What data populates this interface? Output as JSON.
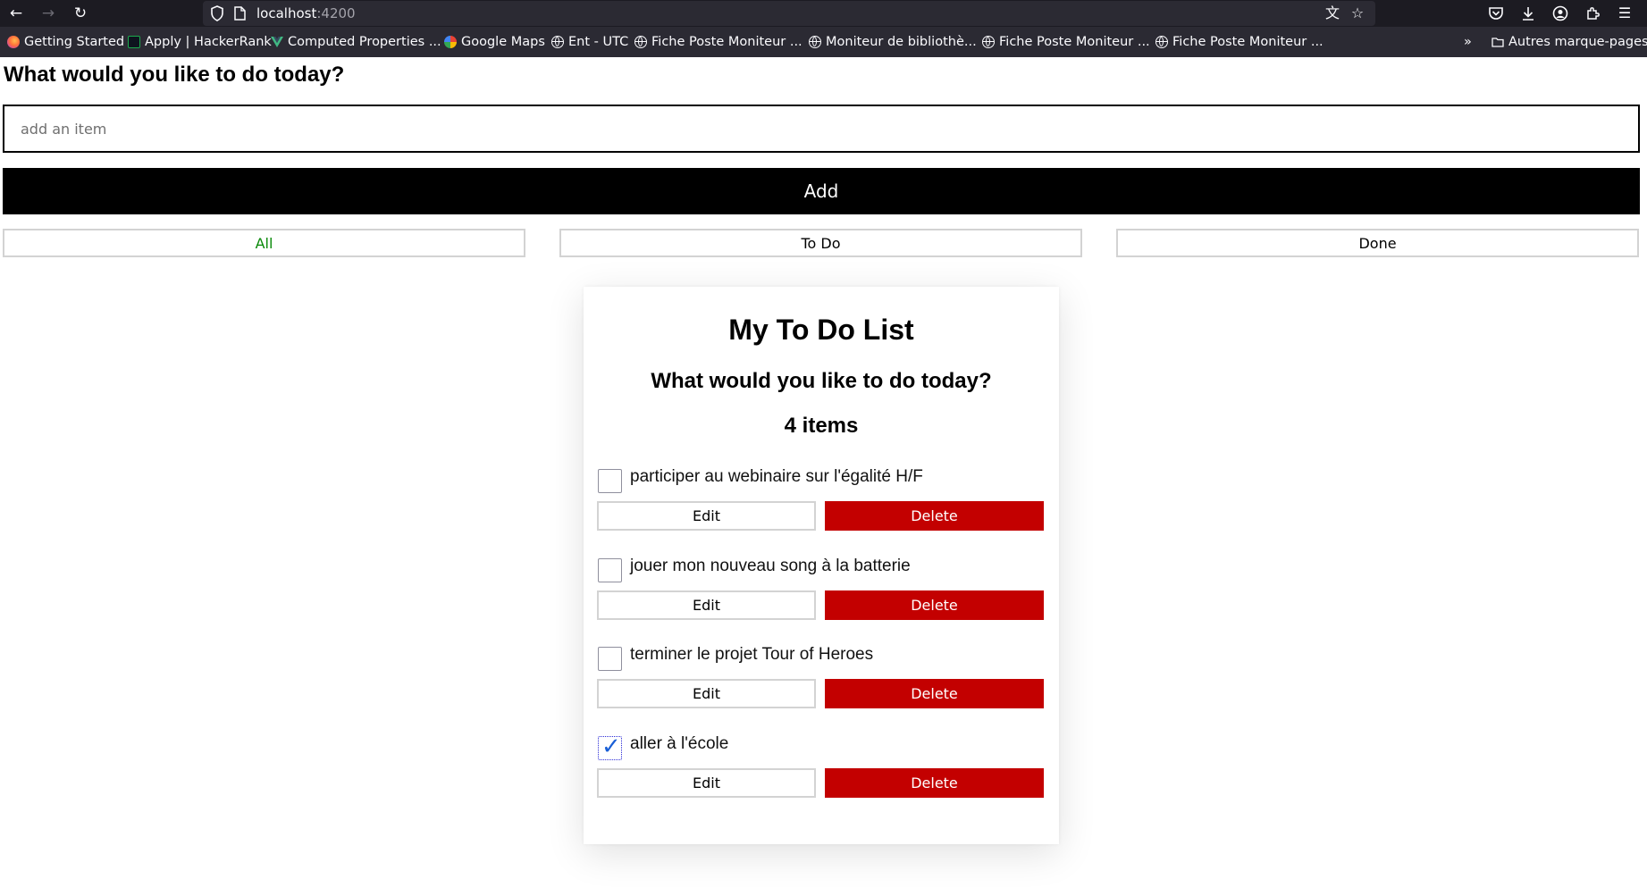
{
  "browser": {
    "url_host": "localhost",
    "url_port": ":4200",
    "bookmarks": [
      {
        "label": "Getting Started",
        "icon": "firefox-icon"
      },
      {
        "label": "Apply | HackerRank",
        "icon": "hackerrank-icon"
      },
      {
        "label": "Computed Properties ...",
        "icon": "vue-icon"
      },
      {
        "label": "Google Maps",
        "icon": "google-icon"
      },
      {
        "label": "Ent - UTC",
        "icon": "globe-icon"
      },
      {
        "label": "Fiche Poste Moniteur ...",
        "icon": "globe-icon"
      },
      {
        "label": "Moniteur de bibliothè...",
        "icon": "globe-icon"
      },
      {
        "label": "Fiche Poste Moniteur ...",
        "icon": "globe-icon"
      },
      {
        "label": "Fiche Poste Moniteur ...",
        "icon": "globe-icon"
      }
    ],
    "other_bookmarks": "Autres marque-pages"
  },
  "page": {
    "heading": "What would you like to do today?",
    "input_placeholder": "add an item",
    "input_value": "",
    "add_label": "Add",
    "filters": [
      {
        "label": "All",
        "active": true
      },
      {
        "label": "To Do",
        "active": false
      },
      {
        "label": "Done",
        "active": false
      }
    ],
    "active_color": "#0a8a0a"
  },
  "card": {
    "title": "My To Do List",
    "subtitle": "What would you like to do today?",
    "count": "4 items",
    "edit_label": "Edit",
    "delete_label": "Delete",
    "delete_color": "#c30000",
    "items": [
      {
        "label": "participer au webinaire sur l'égalité H/F",
        "done": false
      },
      {
        "label": "jouer mon nouveau song à la batterie",
        "done": false
      },
      {
        "label": "terminer le projet Tour of Heroes",
        "done": false
      },
      {
        "label": "aller à l'école",
        "done": true
      }
    ]
  }
}
